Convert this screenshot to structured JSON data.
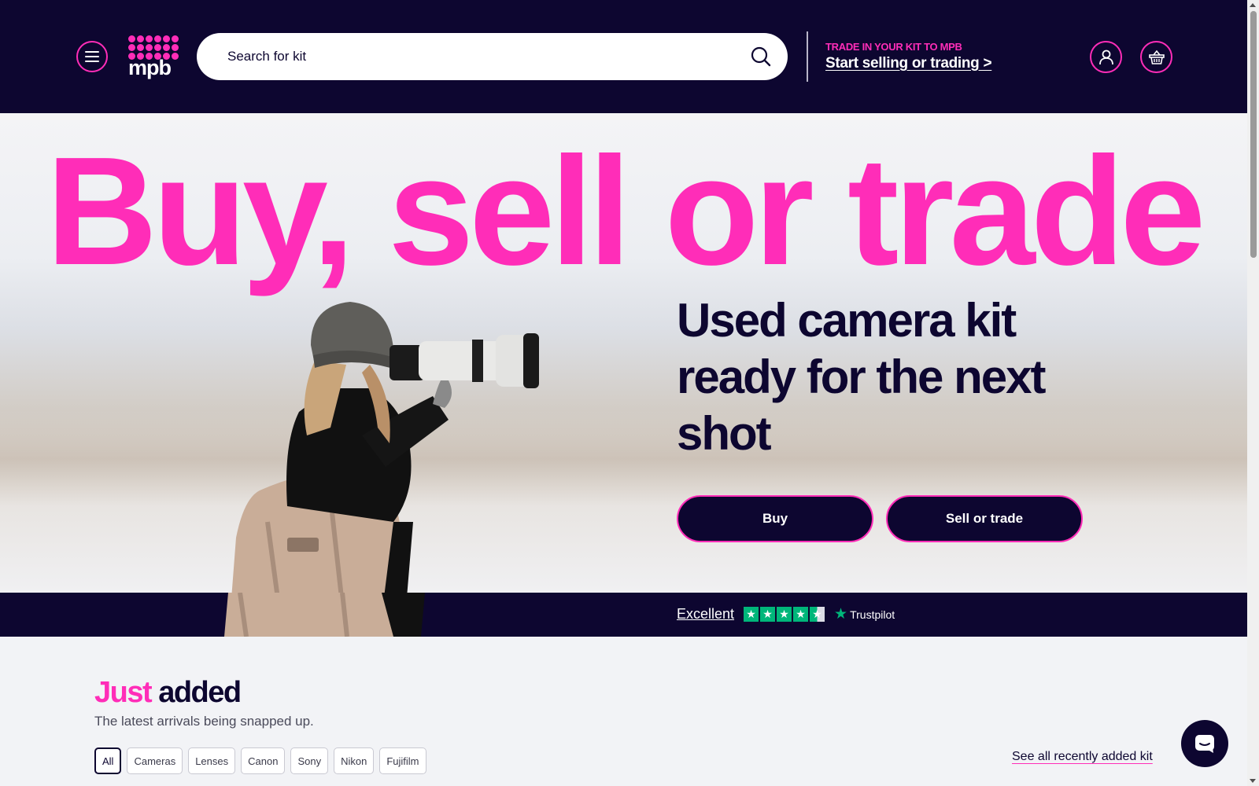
{
  "header": {
    "logo_text": "mpb",
    "search_placeholder": "Search for kit",
    "trade_eyebrow": "TRADE IN YOUR KIT TO MPB",
    "trade_link": "Start selling or trading >",
    "icons": [
      "menu-icon",
      "search-icon",
      "account-icon",
      "basket-icon"
    ]
  },
  "hero": {
    "title": "Buy, sell or trade",
    "subtitle": "Used camera kit ready for the next shot",
    "buy_button": "Buy",
    "sell_button": "Sell or trade"
  },
  "trustpilot": {
    "rating_text": "Excellent",
    "stars": 4.5,
    "brand": "Trustpilot"
  },
  "just_added": {
    "title_highlight": "Just",
    "title_rest": "added",
    "subtitle": "The latest arrivals being snapped up.",
    "filters": [
      "All",
      "Cameras",
      "Lenses",
      "Canon",
      "Sony",
      "Nikon",
      "Fujifilm"
    ],
    "active_filter": "All",
    "see_all": "See all recently added kit"
  },
  "colors": {
    "navy": "#0d0630",
    "pink": "#ff2db8",
    "trustpilot_green": "#00b67a"
  }
}
